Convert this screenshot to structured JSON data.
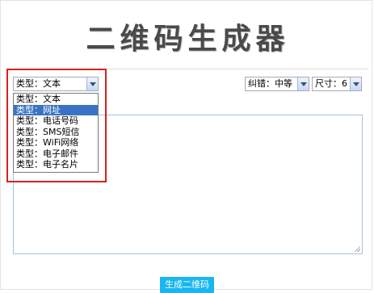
{
  "page": {
    "title": "二维码生成器"
  },
  "type_select": {
    "value": "类型：文本",
    "options": [
      "类型：文本",
      "类型：网址",
      "类型：电话号码",
      "类型：SMS短信",
      "类型：WiFi网络",
      "类型：电子邮件",
      "类型：电子名片"
    ],
    "highlighted_option": "类型：网址"
  },
  "error_correction_select": {
    "value": "纠错：中等"
  },
  "size_select": {
    "value": "尺寸：6"
  },
  "content_textarea": {
    "value": ""
  },
  "generate_button": {
    "label": "生成二维码"
  },
  "colors": {
    "accent": "#1ab6f0",
    "selected_option": "#3a73c3",
    "highlight_box": "#d9201e"
  }
}
